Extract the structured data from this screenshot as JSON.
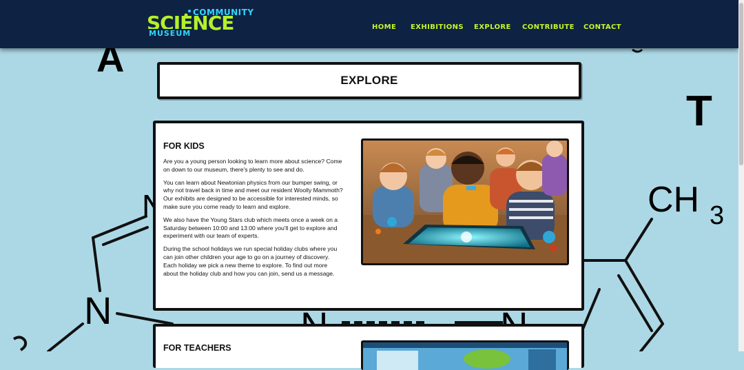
{
  "header": {
    "logo": {
      "top": "COMMUNITY",
      "main": "SCIENCE",
      "bottom": "MUSEUM"
    },
    "nav": [
      {
        "label": "HOME"
      },
      {
        "label": "EXHIBITIONS"
      },
      {
        "label": "EXPLORE"
      },
      {
        "label": "CONTRIBUTE"
      },
      {
        "label": "CONTACT"
      }
    ]
  },
  "background": {
    "letters": [
      "A",
      "T",
      "N",
      "N",
      "CH",
      "3",
      "N",
      "N"
    ]
  },
  "page": {
    "title": "EXPLORE"
  },
  "sections": [
    {
      "heading": "FOR KIDS",
      "paragraphs": [
        "Are you a young person looking to learn more about science? Come on down to our museum, there's plenty to see and do.",
        "You can learn about Newtonian physics from our bumper swing, or why not travel back in time and meet our resident Woolly Mammoth? Our exhibits are designed to be accessible for interested minds, so make sure you come ready to learn and explore.",
        "We also have the Young Stars club which meets once a week on a Saturday between 10:00 and 13:00 where you'll get to explore and experiment with our team of experts.",
        "During the school holidays we run special holiday clubs where you can join other children your age to go on a journey of discovery. Each holiday we pick a new theme to explore. To find out more about the holiday club and how you can join, send us a message."
      ],
      "image": "children-science-table-photo"
    },
    {
      "heading": "FOR TEACHERS",
      "image": "teachers-section-photo"
    }
  ],
  "colors": {
    "background": "#acd8e6",
    "header": "#0e2244",
    "nav_text": "#c6f52a",
    "logo_cyan": "#2fd6ff",
    "logo_green": "#b6f02a"
  }
}
